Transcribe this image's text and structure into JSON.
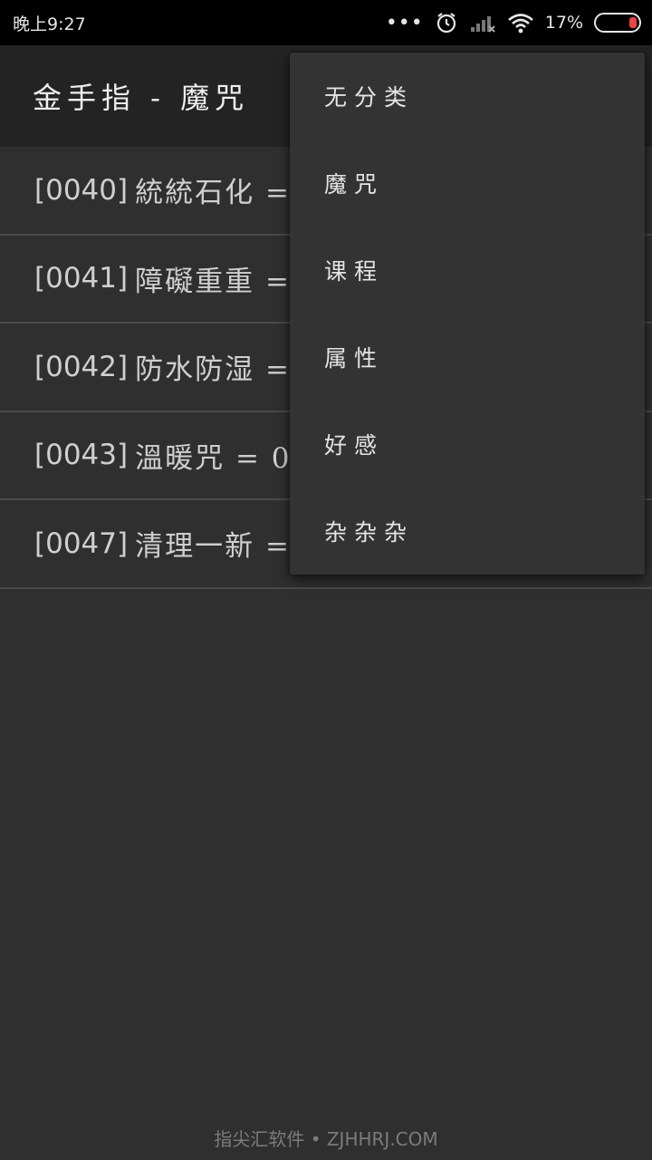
{
  "status_bar": {
    "time": "晚上9:27",
    "more_dots": "•••",
    "battery_percent": "17%",
    "icons": [
      "alarm-icon",
      "signal-icon",
      "wifi-icon",
      "battery-icon"
    ]
  },
  "toolbar": {
    "title": "金手指 - 魔咒"
  },
  "list": {
    "rows": [
      {
        "code": "[0040]",
        "text": "統統石化 ="
      },
      {
        "code": "[0041]",
        "text": "障礙重重 ="
      },
      {
        "code": "[0042]",
        "text": "防水防湿 ="
      },
      {
        "code": "[0043]",
        "text": "溫暖咒 = 0"
      },
      {
        "code": "[0047]",
        "text": "清理一新 ="
      }
    ]
  },
  "menu": {
    "items": [
      "无分类",
      "魔咒",
      "课程",
      "属性",
      "好感",
      "杂杂杂"
    ]
  },
  "watermark": "指尖汇软件 • ZJHHRJ.COM",
  "colors": {
    "background": "#2f2f2f",
    "toolbar": "#232323",
    "menu": "#333333",
    "battery_low": "#e84545"
  }
}
